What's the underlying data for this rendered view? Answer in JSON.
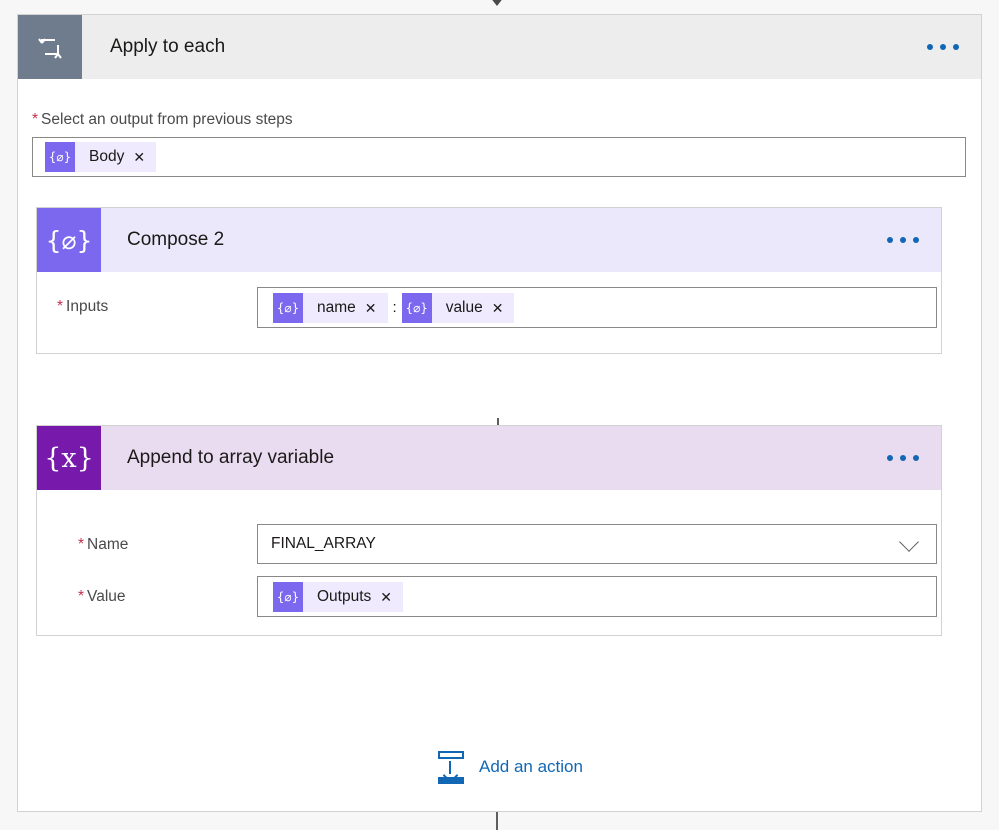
{
  "colors": {
    "accent_blue": "#1267b4",
    "scope_icon_bg": "#6f7c8d",
    "compose_icon_bg": "#7b68ee",
    "variable_icon_bg": "#7719aa",
    "compose_header_bg": "#ece8fb",
    "variable_header_bg": "#eadcf0",
    "scope_header_bg": "#ededed",
    "token_bg": "#efeafd",
    "required_star": "#c4314b",
    "connector": "#4a4a4a"
  },
  "scope": {
    "title": "Apply to each",
    "icon": "loop-icon",
    "menu_icon": "ellipsis-icon",
    "input_field": {
      "label": "Select an output from previous steps",
      "required": true,
      "tokens": [
        {
          "glyph": "{⌀}",
          "text": "Body",
          "remove": "✕"
        }
      ]
    }
  },
  "actions": [
    {
      "id": "compose-2",
      "title": "Compose 2",
      "icon": "compose-icon",
      "icon_glyph": "{⌀}",
      "menu_icon": "ellipsis-icon",
      "fields": [
        {
          "label": "Inputs",
          "required": true,
          "type": "token-input",
          "tokens": [
            {
              "glyph": "{⌀}",
              "text": "name",
              "remove": "✕"
            },
            {
              "glyph": "{⌀}",
              "text": "value",
              "remove": "✕"
            }
          ],
          "separator": ":"
        }
      ]
    },
    {
      "id": "append-to-array-variable",
      "title": "Append to array variable",
      "icon": "variable-icon",
      "icon_glyph": "{x}",
      "menu_icon": "ellipsis-icon",
      "fields": [
        {
          "label": "Name",
          "required": true,
          "type": "dropdown",
          "value": "FINAL_ARRAY",
          "chevron": "chevron-down-icon"
        },
        {
          "label": "Value",
          "required": true,
          "type": "token-input",
          "tokens": [
            {
              "glyph": "{⌀}",
              "text": "Outputs",
              "remove": "✕"
            }
          ]
        }
      ]
    }
  ],
  "add_action": {
    "label": "Add an action",
    "icon": "add-action-icon"
  }
}
